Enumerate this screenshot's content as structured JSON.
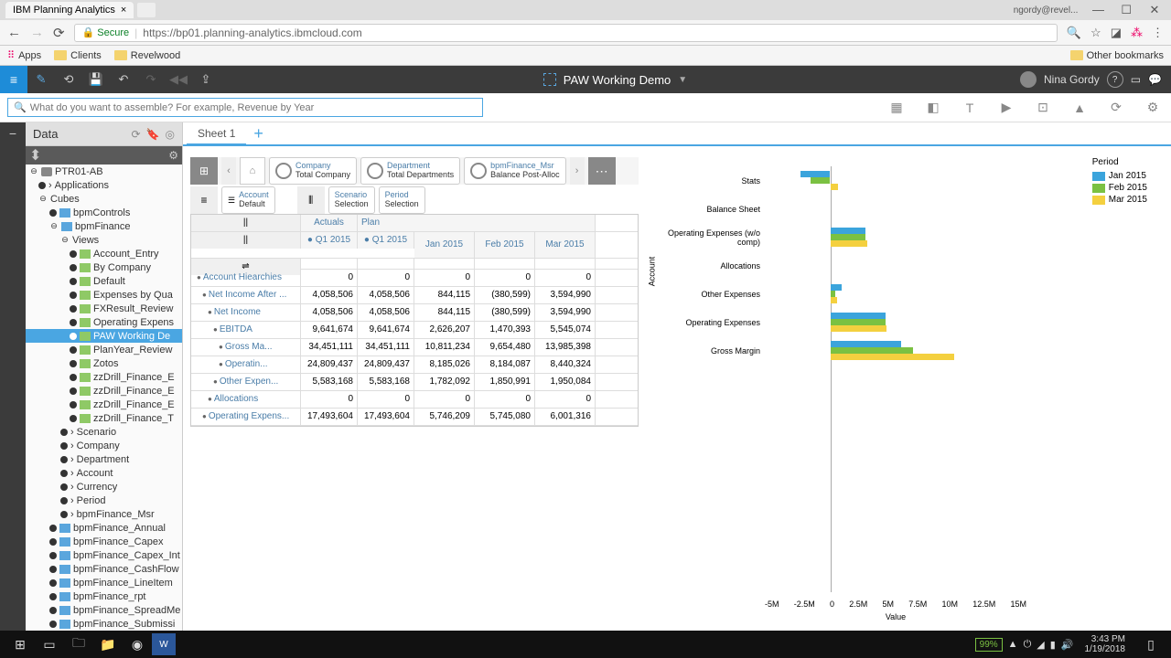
{
  "browser": {
    "tab_title": "IBM Planning Analytics",
    "user_hint": "ngordy@revel...",
    "secure_label": "Secure",
    "url": "https://bp01.planning-analytics.ibmcloud.com",
    "bookmarks": {
      "apps": "Apps",
      "clients": "Clients",
      "revelwood": "Revelwood",
      "other": "Other bookmarks"
    }
  },
  "app": {
    "title": "PAW Working Demo",
    "user": "Nina Gordy",
    "search_placeholder": "What do you want to assemble? For example, Revenue by Year"
  },
  "data_panel": {
    "title": "Data",
    "db": "PTR01-AB",
    "applications": "Applications",
    "cubes": "Cubes",
    "items": [
      "bpmControls",
      "bpmFinance"
    ],
    "views_label": "Views",
    "views": [
      "Account_Entry",
      "By Company",
      "Default",
      "Expenses by Qua",
      "FXResult_Review",
      "Operating Expens",
      "PAW Working De",
      "PlanYear_Review",
      "Zotos",
      "zzDrill_Finance_E",
      "zzDrill_Finance_E",
      "zzDrill_Finance_E",
      "zzDrill_Finance_T"
    ],
    "selected_view_index": 6,
    "dims": [
      "Scenario",
      "Company",
      "Department",
      "Account",
      "Currency",
      "Period",
      "bpmFinance_Msr"
    ],
    "cubes2": [
      "bpmFinance_Annual",
      "bpmFinance_Capex",
      "bpmFinance_Capex_Int",
      "bpmFinance_CashFlow",
      "bpmFinance_LineItem",
      "bpmFinance_rpt",
      "bpmFinance_SpreadMe",
      "bpmFinance_Submissi"
    ]
  },
  "sheet": {
    "tab": "Sheet 1"
  },
  "grid": {
    "context": [
      {
        "top": "Company",
        "bot": "Total Company"
      },
      {
        "top": "Department",
        "bot": "Total Departments"
      },
      {
        "top": "bpmFinance_Msr",
        "bot": "Balance Post-Alloc"
      }
    ],
    "row_dim": {
      "top": "Account",
      "bot": "Default"
    },
    "col_dims": [
      {
        "top": "Scenario",
        "bot": "Selection"
      },
      {
        "top": "Period",
        "bot": "Selection"
      }
    ],
    "scenario_headers": [
      "Actuals",
      "Plan"
    ],
    "period_actual": "Q1 2015",
    "period_plan": "Q1 2015",
    "months": [
      "Jan 2015",
      "Feb 2015",
      "Mar 2015"
    ],
    "rows": [
      {
        "label": "Account Hiearchies",
        "v": [
          "0",
          "0",
          "0",
          "0",
          "0"
        ]
      },
      {
        "label": "Net Income After ...",
        "v": [
          "4,058,506",
          "4,058,506",
          "844,115",
          "(380,599)",
          "3,594,990"
        ]
      },
      {
        "label": "Net Income",
        "v": [
          "4,058,506",
          "4,058,506",
          "844,115",
          "(380,599)",
          "3,594,990"
        ]
      },
      {
        "label": "EBITDA",
        "v": [
          "9,641,674",
          "9,641,674",
          "2,626,207",
          "1,470,393",
          "5,545,074"
        ]
      },
      {
        "label": "Gross Ma...",
        "v": [
          "34,451,111",
          "34,451,111",
          "10,811,234",
          "9,654,480",
          "13,985,398"
        ]
      },
      {
        "label": "Operatin...",
        "v": [
          "24,809,437",
          "24,809,437",
          "8,185,026",
          "8,184,087",
          "8,440,324"
        ]
      },
      {
        "label": "Other Expen...",
        "v": [
          "5,583,168",
          "5,583,168",
          "1,782,092",
          "1,850,991",
          "1,950,084"
        ]
      },
      {
        "label": "Allocations",
        "v": [
          "0",
          "0",
          "0",
          "0",
          "0"
        ]
      },
      {
        "label": "Operating Expens...",
        "v": [
          "17,493,604",
          "17,493,604",
          "5,746,209",
          "5,745,080",
          "6,001,316"
        ]
      }
    ]
  },
  "chart_data": {
    "type": "bar",
    "orientation": "horizontal",
    "xlabel": "Value",
    "ylabel": "Account",
    "legend_title": "Period",
    "x_ticks": [
      "-5M",
      "-2.5M",
      "0",
      "2.5M",
      "5M",
      "7.5M",
      "10M",
      "12.5M",
      "15M"
    ],
    "x_range": [
      -5,
      15
    ],
    "categories": [
      "Stats",
      "Balance Sheet",
      "Operating Expenses (w/o comp)",
      "Allocations",
      "Other Expenses",
      "Operating Expenses",
      "Gross Margin"
    ],
    "series": [
      {
        "name": "Jan 2015",
        "color": "#3ba4dc",
        "values": [
          -2.3,
          0,
          2.7,
          0,
          0.9,
          4.2,
          5.4
        ]
      },
      {
        "name": "Feb 2015",
        "color": "#7bc142",
        "values": [
          -1.5,
          0,
          2.7,
          0,
          0.4,
          4.2,
          6.3
        ]
      },
      {
        "name": "Mar 2015",
        "color": "#f4d03f",
        "values": [
          0.6,
          0,
          2.8,
          0,
          0.5,
          4.3,
          9.5
        ]
      }
    ]
  },
  "taskbar": {
    "battery": "99%",
    "time": "3:43 PM",
    "date": "1/19/2018"
  }
}
